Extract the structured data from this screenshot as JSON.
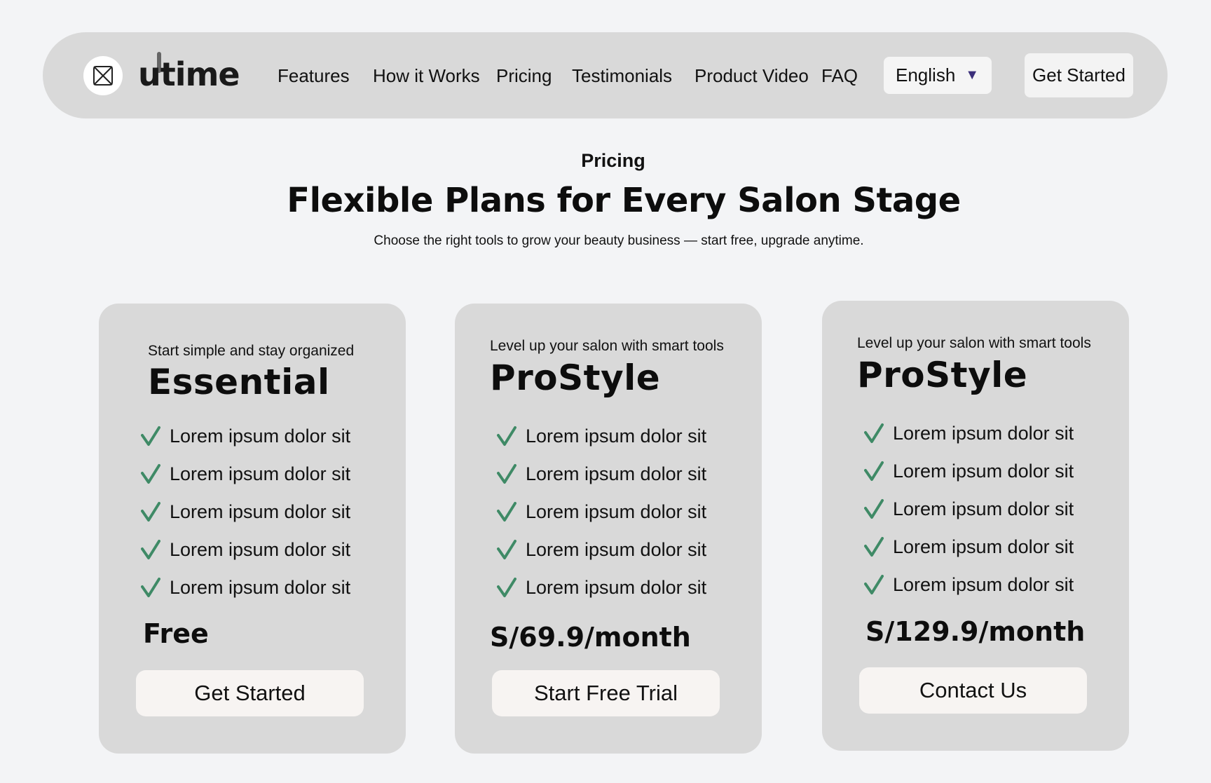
{
  "nav": {
    "brand": "utime",
    "links": [
      "Features",
      "How it Works",
      "Pricing",
      "Testimonials",
      "Product Video",
      "FAQ"
    ],
    "language": "English",
    "cta": "Get Started"
  },
  "header": {
    "eyebrow": "Pricing",
    "title": "Flexible Plans for Every Salon Stage",
    "subtitle": "Choose the right tools to grow your beauty business — start free, upgrade anytime."
  },
  "plans": [
    {
      "tagline": "Start simple and stay organized",
      "name": "Essential",
      "features": [
        "Lorem ipsum dolor sit",
        "Lorem ipsum dolor sit",
        "Lorem ipsum dolor sit",
        "Lorem ipsum dolor sit",
        "Lorem ipsum dolor sit"
      ],
      "price": "Free",
      "button": "Get Started"
    },
    {
      "tagline": "Level up your salon with smart tools",
      "name": "ProStyle",
      "features": [
        "Lorem ipsum dolor sit",
        "Lorem ipsum dolor sit",
        "Lorem ipsum dolor sit",
        "Lorem ipsum dolor sit",
        "Lorem ipsum dolor sit"
      ],
      "price": "S/69.9/month",
      "button": "Start Free Trial"
    },
    {
      "tagline": "Level up your salon with smart tools",
      "name": "ProStyle",
      "features": [
        "Lorem ipsum dolor sit",
        "Lorem ipsum dolor sit",
        "Lorem ipsum dolor sit",
        "Lorem ipsum dolor sit",
        "Lorem ipsum dolor sit"
      ],
      "price": "S/129.9/month",
      "button": "Contact Us"
    }
  ],
  "colors": {
    "background": "#f3f4f6",
    "surface": "#d9d9d9",
    "check": "#3f8a66",
    "caret": "#3b2f7a"
  },
  "icons": {
    "logo": "image-placeholder-icon",
    "language_caret": "caret-down-icon",
    "feature_bullet": "checkmark-icon"
  }
}
